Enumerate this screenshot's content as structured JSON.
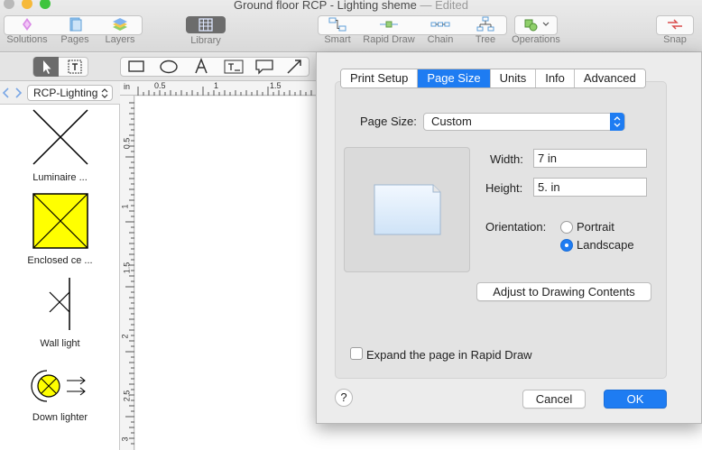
{
  "window": {
    "title": "Ground floor RCP - Lighting sheme",
    "status": "— Edited"
  },
  "toolbar": {
    "solutions": "Solutions",
    "pages": "Pages",
    "layers": "Layers",
    "library": "Library",
    "smart": "Smart",
    "rapid_draw": "Rapid Draw",
    "chain": "Chain",
    "tree": "Tree",
    "operations": "Operations",
    "snap": "Snap"
  },
  "library_panel": {
    "selected_library": "RCP-Lighting",
    "shapes": [
      {
        "label": "Luminaire ..."
      },
      {
        "label": "Enclosed ce ..."
      },
      {
        "label": "Wall light"
      },
      {
        "label": "Down lighter"
      }
    ]
  },
  "ruler": {
    "unit": "in",
    "h_ticks": [
      "0.5",
      "1",
      "1.5"
    ],
    "v_ticks": [
      "0.5",
      "1",
      "1.5",
      "2",
      "2.5",
      "3"
    ]
  },
  "dialog": {
    "tabs": [
      "Print Setup",
      "Page Size",
      "Units",
      "Info",
      "Advanced"
    ],
    "active_tab": "Page Size",
    "page_size_label": "Page Size:",
    "page_size_value": "Custom",
    "width_label": "Width:",
    "width_value": "7 in",
    "height_label": "Height:",
    "height_value": "5. in",
    "orientation_label": "Orientation:",
    "portrait_label": "Portrait",
    "landscape_label": "Landscape",
    "selected_orientation": "Landscape",
    "adjust_button": "Adjust to Drawing Contents",
    "expand_label": "Expand the page in Rapid Draw",
    "expand_checked": false,
    "help_label": "?",
    "cancel_button": "Cancel",
    "ok_button": "OK"
  },
  "colors": {
    "accent": "#1e7cf2",
    "shape_fill": "#ffff00"
  }
}
